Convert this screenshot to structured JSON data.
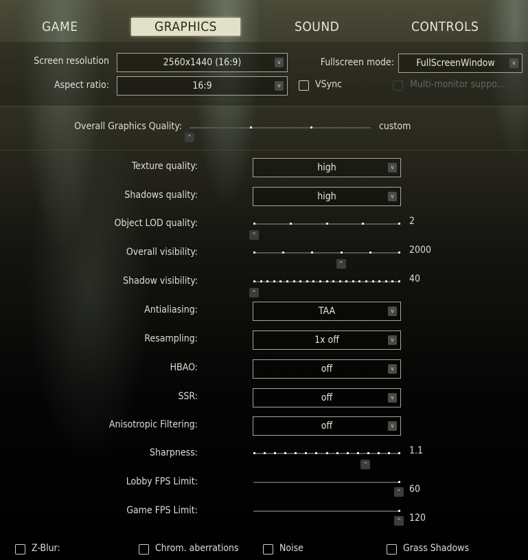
{
  "tabs": [
    {
      "label": "GAME",
      "active": false
    },
    {
      "label": "GRAPHICS",
      "active": true
    },
    {
      "label": "SOUND",
      "active": false
    },
    {
      "label": "CONTROLS",
      "active": false
    }
  ],
  "top": {
    "screen_resolution": {
      "label": "Screen resolution",
      "value": "2560x1440 (16:9)"
    },
    "aspect_ratio": {
      "label": "Aspect ratio:",
      "value": "16:9"
    },
    "fullscreen_mode": {
      "label": "Fullscreen mode:",
      "value": "FullScreenWindow"
    },
    "vsync": {
      "label": "VSync",
      "checked": false
    },
    "multi_monitor": {
      "label": "Multi-monitor suppo...",
      "checked": false,
      "disabled": true
    }
  },
  "overall": {
    "label": "Overall Graphics Quality:",
    "value": "custom",
    "level": 0
  },
  "settings": [
    {
      "type": "dropdown",
      "label": "Texture quality:",
      "value": "high"
    },
    {
      "type": "dropdown",
      "label": "Shadows quality:",
      "value": "high"
    },
    {
      "type": "slider",
      "label": "Object LOD quality:",
      "value": "2",
      "level": 0,
      "ticks": 5
    },
    {
      "type": "slider",
      "label": "Overall visibility:",
      "value": "2000",
      "level": 0.6,
      "ticks": 6
    },
    {
      "type": "slider",
      "label": "Shadow visibility:",
      "value": "40",
      "level": 0,
      "ticks": 23
    },
    {
      "type": "dropdown",
      "label": "Antialiasing:",
      "value": "TAA"
    },
    {
      "type": "dropdown",
      "label": "Resampling:",
      "value": "1x off"
    },
    {
      "type": "dropdown",
      "label": "HBAO:",
      "value": "off"
    },
    {
      "type": "dropdown",
      "label": "SSR:",
      "value": "off"
    },
    {
      "type": "dropdown",
      "label": "Anisotropic Filtering:",
      "value": "off"
    },
    {
      "type": "slider",
      "label": "Sharpness:",
      "value": "1.1",
      "level": 0.77,
      "ticks": 15
    },
    {
      "type": "slider",
      "label": "Lobby FPS Limit:",
      "value": "60",
      "level": 1,
      "ticks": 0
    },
    {
      "type": "slider",
      "label": "Game FPS Limit:",
      "value": "120",
      "level": 1,
      "ticks": 0
    }
  ],
  "checkboxes": [
    {
      "label": "Z-Blur:",
      "checked": false
    },
    {
      "label": "Chrom. aberrations",
      "checked": false
    },
    {
      "label": "Noise",
      "checked": false
    },
    {
      "label": "Grass Shadows",
      "checked": false
    }
  ],
  "icons": {
    "dropdown": "chevron-down-icon",
    "thumb": "chevron-up-icon"
  }
}
